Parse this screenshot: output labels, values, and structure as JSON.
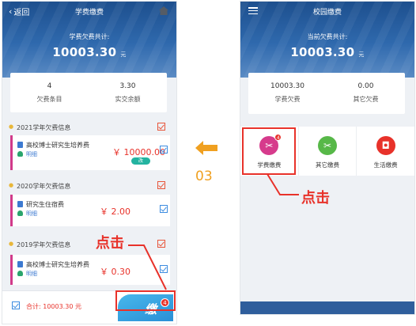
{
  "left": {
    "back_label": "返回",
    "title": "学费缴费",
    "owed_label": "学费欠费共计:",
    "owed_amount": "10003.30",
    "owed_unit": "元",
    "summary": [
      {
        "value": "4",
        "label": "欠费条目"
      },
      {
        "value": "3.30",
        "label": "实交余额"
      }
    ],
    "years": [
      {
        "title": "2021学年欠费信息",
        "items": [
          {
            "name": "高校博士研究生培养费",
            "link": "明细",
            "amount": "￥ 10000.00",
            "badge": "改"
          }
        ]
      },
      {
        "title": "2020学年欠费信息",
        "items": [
          {
            "name": "研究生住宿费",
            "link": "明细",
            "amount": "￥ 2.00"
          }
        ]
      },
      {
        "title": "2019学年欠费信息",
        "items": [
          {
            "name": "高校博士研究生培养费",
            "link": "明细",
            "amount": "￥ 0.30"
          }
        ]
      }
    ],
    "total_label": "合计: 10003.30 元",
    "pay_label": "缴",
    "pay_badge": "4"
  },
  "right": {
    "title": "校园缴费",
    "owed_label": "当前欠费共计:",
    "owed_amount": "10003.30",
    "owed_unit": "元",
    "summary": [
      {
        "value": "10003.30",
        "label": "学费欠费"
      },
      {
        "value": "0.00",
        "label": "其它欠费"
      }
    ],
    "grid": [
      {
        "label": "学费缴费",
        "icon": "scissors-icon",
        "glyph": "✂",
        "color": "#d63b8c",
        "badge": "4"
      },
      {
        "label": "其它缴费",
        "icon": "scissors-icon",
        "glyph": "✂",
        "color": "#57b848"
      },
      {
        "label": "生活缴费",
        "icon": "wallet-icon",
        "glyph": "◘",
        "color": "#e8322a"
      }
    ]
  },
  "annotations": {
    "click_label": "点击",
    "step_number": "03",
    "accent_red": "#e8322a",
    "accent_orange": "#f0a020"
  }
}
